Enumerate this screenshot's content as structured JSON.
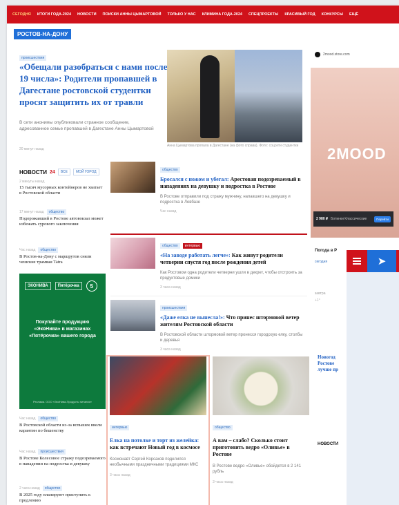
{
  "nav": [
    "Сегодня",
    "Итоги года-2024",
    "Новости",
    "Поиски Анны Цымартовой",
    "Только у нас",
    "Климина года-2024",
    "Спецпроекты",
    "Красивый год",
    "Конкурсы",
    "Ещё"
  ],
  "city_badge": "РОСТОВ-НА-ДОНУ",
  "hero": {
    "tag": "происшествия",
    "title": "«Обещали разобраться с нами после 19 числа»: Родители пропавшей в Дагестане ростовской студентки просят защитить их от травли",
    "lead": "В сети анонимы опубликовали странное сообщение, адресованное семье пропавшей в Дагестане Анны Цымартовой",
    "time": "20 минут назад",
    "caption": "Анна Цымартова пропала в Дагестане (на фото справа). Фото: соцсети студентки"
  },
  "news": {
    "title": "НОВОСТИ",
    "count": "24",
    "btn_all": "ВСЕ",
    "btn_city": "МОЙ ГОРОД",
    "items": [
      {
        "time": "2 минуты назад",
        "tag": "",
        "text": "15 тысяч мусорных контейнеров не хватает в Ростовской области"
      },
      {
        "time": "17 минут назад",
        "tag": "общество",
        "text": "Подорожавший в Ростове автовокзал может избежать сурового заключения"
      },
      {
        "time": "Час назад",
        "tag": "общество",
        "text": "В Ростов-на-Дону с маршрутов сняли чешские трамваи Tatra"
      },
      {
        "time": "Час назад",
        "tag": "общество",
        "text": "В Ростовской области из-за вспышек ввели карантин по бешенству"
      },
      {
        "time": "Час назад",
        "tag": "происшествия",
        "text": "В Ростове Колесовое стражу подозреваемого в нападении на подростка и девушку"
      },
      {
        "time": "2 часа назад",
        "tag": "общество",
        "text": "В 2025 году планируют приступить к продлению"
      }
    ]
  },
  "promo": {
    "logo1": "ЭКОНИВА",
    "logo2": "Пятёрочка",
    "logo3": "5",
    "text": "Покупайте продукцию «ЭкоНива» в магазинах «Пятёрочка» вашего города",
    "small": "Реклама. ООО «ЭкоНива-Продукты питания»"
  },
  "feed": [
    {
      "tag": "общество",
      "tag2": "",
      "hl": "Бросался с ножом и убегал:",
      "rest": " Арестован подозреваемый в нападениях на девушку и подростка в Ростове",
      "lead": "В Ростове отправили под стражу мужчину, напавшего на девушку и подростка в Левбазе",
      "time": "Час назад"
    },
    {
      "tag": "общество",
      "tag2": "интервью",
      "hl": "«На заводе работать легче»:",
      "rest": " Как живут родители четверни спустя год после рождения детей",
      "lead": "Как Ростовом одна родители четверни ушли в декрет, чтобы отстроить за продуктовые домики",
      "time": "3 часа назад"
    },
    {
      "tag": "происшествия",
      "tag2": "",
      "hl": "«Даже елка не вынесла!»:",
      "rest": " Что принес штормовой ветер жителям Ростовской области",
      "lead": "В Ростовской области штормовой ветер пронесся городскую елку, столбы и деревья",
      "time": "3 часа назад"
    }
  ],
  "cards": [
    {
      "tag": "интервью",
      "hl": "Елка на потолке и торт из желейка:",
      "rest": " как встречают Новый год в космосе",
      "lead": "Космонавт Сергей Корсаков поделился необычными праздничными традициями МКС",
      "time": "3 часа назад"
    },
    {
      "tag": "общество",
      "hl": "",
      "rest": "А вам – слабо? Сколько стоит приготовить ведро «Оливье» в Ростове",
      "lead": "В Ростове ведро «Оливье» обойдется в 2 141 рубль",
      "time": "3 часа назад"
    }
  ],
  "ad": {
    "top": "2mood.store.com",
    "brand": "2MOOD",
    "price": "2 980 ₽",
    "price_sub": "Ботинки Классические",
    "button": "Перейти"
  },
  "weather": {
    "title": "Погода в Р",
    "day": "сегодня",
    "day2": "завтра",
    "temp": "+1°"
  },
  "side_news_title": "Новогод Ростове лучше пр",
  "side_lower": "НОВОСТИ",
  "overlay_arrow": "➤"
}
